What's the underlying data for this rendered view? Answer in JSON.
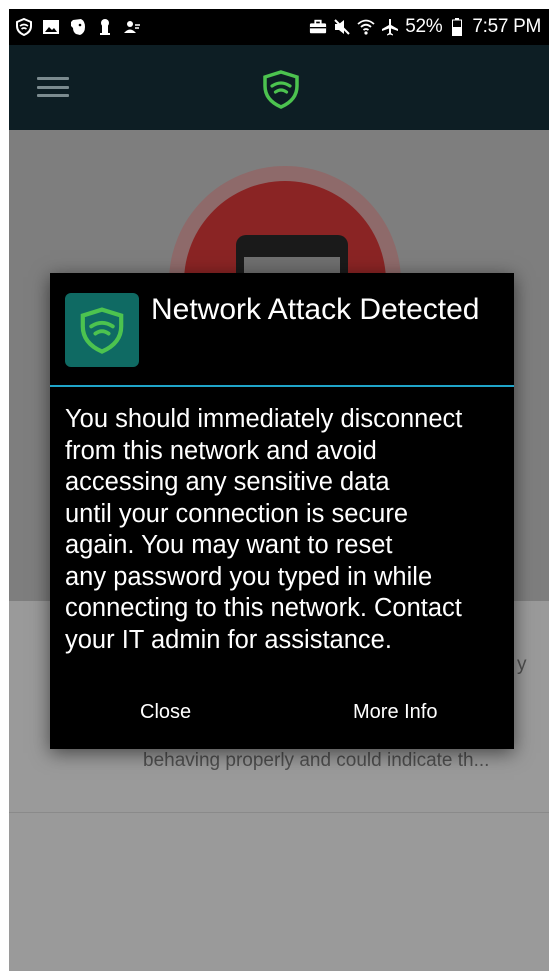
{
  "status_bar": {
    "battery_percent": "52%",
    "time": "7:57 PM",
    "left_icons": [
      "shield-vpn-icon",
      "image-icon",
      "evernote-icon",
      "keyhole-icon",
      "contacts-icon"
    ],
    "right_icons": [
      "briefcase-icon",
      "mute-icon",
      "wifi-icon",
      "airplane-icon",
      "battery-icon"
    ]
  },
  "app_bar": {
    "menu_icon": "hamburger-menu-icon",
    "logo_icon": "lookout-shield-logo-icon"
  },
  "background": {
    "truncated_text": "behaving properly and could indicate th...",
    "partial_char": "y"
  },
  "dialog": {
    "icon": "lookout-shield-logo-icon",
    "title": "Network Attack Detected",
    "message": "You should immediately disconnect\nfrom this network and avoid\naccessing any sensitive data\nuntil your connection is secure\nagain. You may want to reset\nany password you typed in while\nconnecting to this network. Contact\nyour IT admin for assistance.",
    "buttons": {
      "close": "Close",
      "more_info": "More Info"
    }
  },
  "colors": {
    "app_bar_bg": "#0d1e24",
    "brand_green": "#4cc34f",
    "dialog_accent": "#1fa4c9",
    "dialog_bg": "#000000",
    "alert_red": "#8a2424"
  }
}
